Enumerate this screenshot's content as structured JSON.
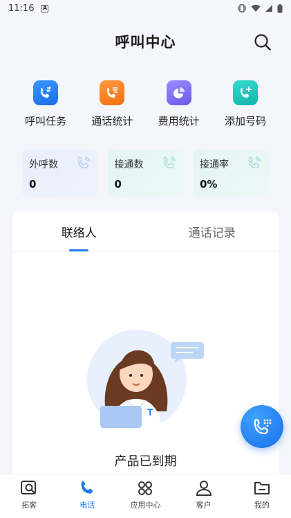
{
  "status_bar": {
    "time": "11:16",
    "notification_icon": "a-icon"
  },
  "header": {
    "title": "呼叫中心"
  },
  "quick_actions": [
    {
      "label": "呼叫任务",
      "icon": "call-task-icon",
      "color": "#1f7cf0"
    },
    {
      "label": "通话统计",
      "icon": "call-stats-icon",
      "color": "#f7821f"
    },
    {
      "label": "费用统计",
      "icon": "cost-stats-icon",
      "color": "#7a6cf4"
    },
    {
      "label": "添加号码",
      "icon": "add-number-icon",
      "color": "#1fc8c0"
    }
  ],
  "stats": [
    {
      "label": "外呼数",
      "value": "0",
      "bg": "#e8eefc"
    },
    {
      "label": "接通数",
      "value": "0",
      "bg": "#e6f6f4"
    },
    {
      "label": "接通率",
      "value": "0%",
      "bg": "#e6f6f4"
    }
  ],
  "tabs": [
    {
      "label": "联络人",
      "active": true
    },
    {
      "label": "通话记录",
      "active": false
    }
  ],
  "empty_state": {
    "message": "产品已到期"
  },
  "bottom_nav": [
    {
      "label": "拓客",
      "icon": "prospect-icon",
      "active": false
    },
    {
      "label": "电话",
      "icon": "phone-icon",
      "active": true
    },
    {
      "label": "应用中心",
      "icon": "app-center-icon",
      "active": false
    },
    {
      "label": "客户",
      "icon": "customer-icon",
      "active": false
    },
    {
      "label": "我的",
      "icon": "my-folder-icon",
      "active": false
    }
  ],
  "colors": {
    "accent": "#1f7cf0"
  }
}
